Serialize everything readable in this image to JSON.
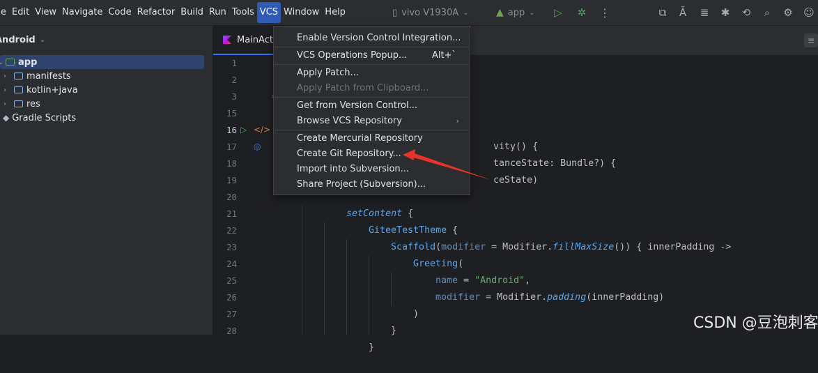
{
  "menubar": {
    "items": [
      "e",
      "Edit",
      "View",
      "Navigate",
      "Code",
      "Refactor",
      "Build",
      "Run",
      "Tools",
      "VCS",
      "Window",
      "Help"
    ],
    "active_index": 9,
    "device_label": "vivo V1930A",
    "run_config_label": "app"
  },
  "project": {
    "title": "Android",
    "tree": [
      {
        "label": "app",
        "kind": "module",
        "depth": 0,
        "expanded": true,
        "selected": true
      },
      {
        "label": "manifests",
        "kind": "folder",
        "depth": 1
      },
      {
        "label": "kotlin+java",
        "kind": "folder",
        "depth": 1
      },
      {
        "label": "res",
        "kind": "folder",
        "depth": 1
      },
      {
        "label": "Gradle Scripts",
        "kind": "gradle",
        "depth": 0
      }
    ]
  },
  "editor": {
    "tab_label": "MainAct",
    "line_numbers": [
      "1",
      "2",
      "3",
      "15",
      "16",
      "17",
      "18",
      "19",
      "20",
      "21",
      "22",
      "23",
      "24",
      "25",
      "26",
      "27",
      "28"
    ],
    "current_line": "16"
  },
  "code": {
    "l16": "vity() {",
    "l17": "tanceState: Bundle?) {",
    "l18": "ceState)",
    "l20_fn": "setContent",
    "l20_rest": " {",
    "l21_fn": "GiteeTestTheme",
    "l21_rest": " {",
    "l22_fn": "Scaffold",
    "l22_p1": "(",
    "l22_param": "modifier",
    "l22_p2": " = Modifier.",
    "l22_call": "fillMaxSize",
    "l22_p3": "()) { innerPadding ->",
    "l23_fn": "Greeting",
    "l23_rest": "(",
    "l24_param": "name",
    "l24_eq": " = ",
    "l24_str": "\"Android\"",
    "l24_comma": ",",
    "l25_param": "modifier",
    "l25_p2": " = Modifier.",
    "l25_call": "padding",
    "l25_p3": "(innerPadding)",
    "l26": ")",
    "l27": "}",
    "l28": "}"
  },
  "vcs_menu": {
    "items": [
      {
        "label": "Enable Version Control Integration...",
        "enabled": true
      },
      {
        "label": "VCS Operations Popup...",
        "shortcut": "Alt+`",
        "enabled": true
      },
      {
        "label": "Apply Patch...",
        "enabled": true
      },
      {
        "label": "Apply Patch from Clipboard...",
        "enabled": false
      },
      {
        "label": "Get from Version Control...",
        "enabled": true
      },
      {
        "label": "Browse VCS Repository",
        "submenu": true,
        "enabled": true
      },
      {
        "label": "Create Mercurial Repository",
        "enabled": true
      },
      {
        "label": "Create Git Repository...",
        "enabled": true
      },
      {
        "label": "Import into Subversion...",
        "enabled": true
      },
      {
        "label": "Share Project (Subversion)...",
        "enabled": true
      }
    ]
  },
  "watermark": "CSDN @豆泡刺客",
  "colors": {
    "accent": "#2f5bb6",
    "selection": "#2e436e",
    "annotation_arrow": "#e8332a"
  }
}
